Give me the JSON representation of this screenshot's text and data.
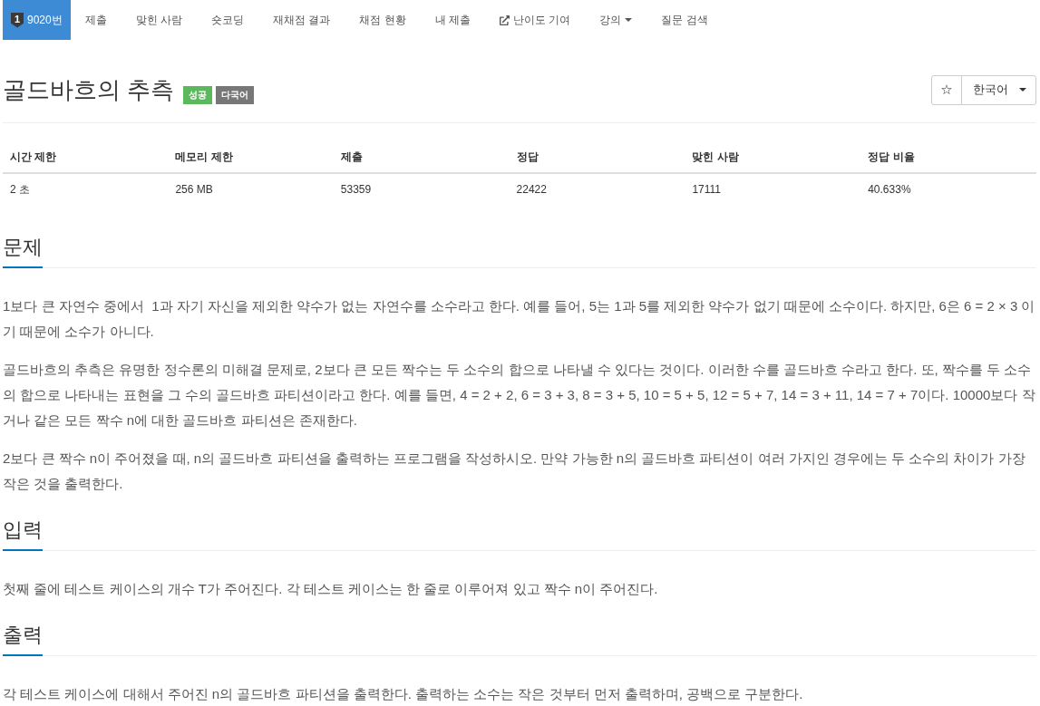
{
  "navbar": {
    "items": [
      {
        "kind": "problem",
        "badge": "1",
        "label": "9020번",
        "selected": true
      },
      {
        "kind": "link",
        "label": "제출",
        "selected": false
      },
      {
        "kind": "link",
        "label": "맞힌 사람",
        "selected": false
      },
      {
        "kind": "link",
        "label": "숏코딩",
        "selected": false
      },
      {
        "kind": "link",
        "label": "재채점 결과",
        "selected": false
      },
      {
        "kind": "link",
        "label": "채점 현황",
        "selected": false
      },
      {
        "kind": "link",
        "label": "내 제출",
        "selected": false
      },
      {
        "kind": "external",
        "label": "난이도 기여",
        "selected": false
      },
      {
        "kind": "dropdown",
        "label": "강의",
        "selected": false
      },
      {
        "kind": "link",
        "label": "질문 검색",
        "selected": false
      }
    ]
  },
  "problem": {
    "title": "골드바흐의 추측",
    "labels": [
      {
        "text": "성공",
        "color": "#5cb85c"
      },
      {
        "text": "다국어",
        "color": "#777777"
      }
    ]
  },
  "actions": {
    "star": "☆",
    "language": "한국어"
  },
  "info_table": {
    "columns": [
      "시간 제한",
      "메모리 제한",
      "제출",
      "정답",
      "맞힌 사람",
      "정답 비율"
    ],
    "rows": [
      [
        "2 초",
        "256 MB",
        "53359",
        "22422",
        "17111",
        "40.633%"
      ]
    ]
  },
  "sections": [
    {
      "heading": "문제",
      "paragraphs": [
        "1보다 큰 자연수 중에서  1과 자기 자신을 제외한 약수가 없는 자연수를 소수라고 한다. 예를 들어, 5는 1과 5를 제외한 약수가 없기 때문에 소수이다. 하지만, 6은 6 = 2 × 3 이기 때문에 소수가 아니다.",
        "골드바흐의 추측은 유명한 정수론의 미해결 문제로, 2보다 큰 모든 짝수는 두 소수의 합으로 나타낼 수 있다는 것이다. 이러한 수를 골드바흐 수라고 한다. 또, 짝수를 두 소수의 합으로 나타내는 표현을 그 수의 골드바흐 파티션이라고 한다. 예를 들면, 4 = 2 + 2, 6 = 3 + 3, 8 = 3 + 5, 10 = 5 + 5, 12 = 5 + 7, 14 = 3 + 11, 14 = 7 + 7이다. 10000보다 작거나 같은 모든 짝수 n에 대한 골드바흐 파티션은 존재한다.",
        "2보다 큰 짝수 n이 주어졌을 때, n의 골드바흐 파티션을 출력하는 프로그램을 작성하시오. 만약 가능한 n의 골드바흐 파티션이 여러 가지인 경우에는 두 소수의 차이가 가장 작은 것을 출력한다."
      ]
    },
    {
      "heading": "입력",
      "paragraphs": [
        "첫째 줄에 테스트 케이스의 개수 T가 주어진다. 각 테스트 케이스는 한 줄로 이루어져 있고 짝수 n이 주어진다."
      ]
    },
    {
      "heading": "출력",
      "paragraphs": [
        "각 테스트 케이스에 대해서 주어진 n의 골드바흐 파티션을 출력한다. 출력하는 소수는 작은 것부터 먼저 출력하며, 공백으로 구분한다."
      ]
    }
  ]
}
